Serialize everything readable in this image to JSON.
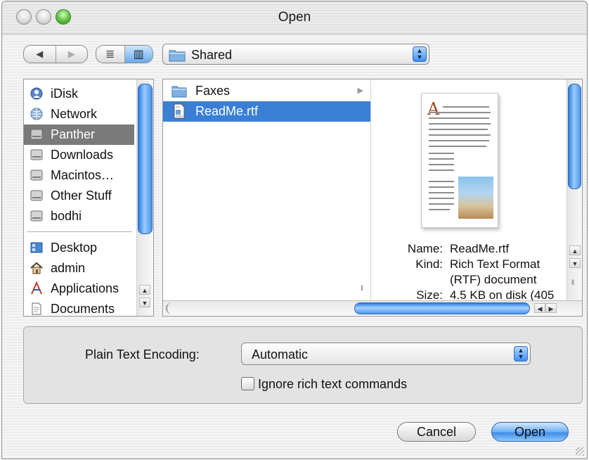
{
  "window": {
    "title": "Open"
  },
  "toolbar": {
    "back": "◀",
    "forward": "▶",
    "view_list": "≣",
    "view_columns": "▥",
    "location": "Shared"
  },
  "sidebar": {
    "items": [
      {
        "label": "iDisk",
        "icon": "idisk-icon"
      },
      {
        "label": "Network",
        "icon": "network-icon"
      },
      {
        "label": "Panther",
        "icon": "hard-drive-icon",
        "selected": true
      },
      {
        "label": "Downloads",
        "icon": "hard-drive-icon"
      },
      {
        "label": "Macintos…",
        "icon": "hard-drive-icon"
      },
      {
        "label": "Other Stuff",
        "icon": "hard-drive-icon"
      },
      {
        "label": "bodhi",
        "icon": "hard-drive-icon"
      },
      {
        "label": "Desktop",
        "icon": "desktop-icon"
      },
      {
        "label": "admin",
        "icon": "home-icon"
      },
      {
        "label": "Applications",
        "icon": "applications-icon"
      },
      {
        "label": "Documents",
        "icon": "documents-icon"
      }
    ]
  },
  "browser": {
    "files": [
      {
        "name": "Faxes",
        "type": "folder"
      },
      {
        "name": "ReadMe.rtf",
        "type": "rtf",
        "selected": true
      }
    ],
    "preview": {
      "name_label": "Name:",
      "name_value": "ReadMe.rtf",
      "kind_label": "Kind:",
      "kind_value_1": "Rich Text Format",
      "kind_value_2": "(RTF) document",
      "size_label": "Size:",
      "size_value": "4.5 KB on disk (405"
    }
  },
  "options": {
    "encoding_label": "Plain Text Encoding:",
    "encoding_value": "Automatic",
    "ignore_rtf_label": "Ignore rich text commands",
    "ignore_rtf_checked": false
  },
  "buttons": {
    "cancel": "Cancel",
    "open": "Open"
  },
  "colors": {
    "selection": "#3a7fd6",
    "sidebar_selection": "#7a7a7a",
    "aqua_blue": "#3f8ce6"
  }
}
